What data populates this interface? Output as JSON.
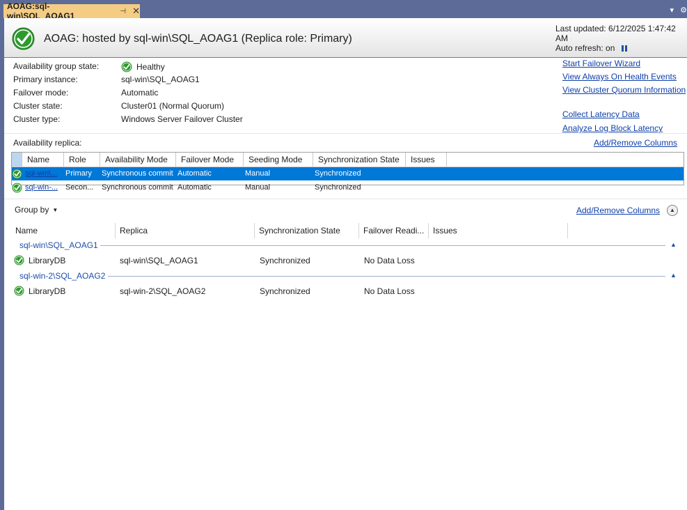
{
  "tab": {
    "title": "AOAG:sql-win\\SQL_AOAG1",
    "pin": "⊣",
    "close": "✕"
  },
  "strip_icons": {
    "dropdown": "▾",
    "settings": "⚙"
  },
  "header": {
    "title": "AOAG: hosted by sql-win\\SQL_AOAG1 (Replica role: Primary)",
    "last_updated": "Last updated: 6/12/2025 1:47:42 AM",
    "auto_refresh": "Auto refresh: on"
  },
  "info": [
    {
      "label": "Availability group state:",
      "value": "Healthy",
      "icon": "check-icon"
    },
    {
      "label": "Primary instance:",
      "value": "sql-win\\SQL_AOAG1"
    },
    {
      "label": "Failover mode:",
      "value": "Automatic"
    },
    {
      "label": "Cluster state:",
      "value": "Cluster01 (Normal Quorum)"
    },
    {
      "label": "Cluster type:",
      "value": "Windows Server Failover Cluster"
    }
  ],
  "links": [
    "Start Failover Wizard",
    "View Always On Health Events",
    "View Cluster Quorum Information",
    "Collect Latency Data",
    "Analyze Log Block Latency"
  ],
  "replica": {
    "label": "Availability replica:",
    "add_remove": "Add/Remove Columns",
    "columns": [
      "Name",
      "Role",
      "Availability Mode",
      "Failover Mode",
      "Seeding Mode",
      "Synchronization State",
      "Issues"
    ],
    "rows": [
      {
        "name": "sql-win\\...",
        "role": "Primary",
        "availability_mode": "Synchronous commit",
        "failover_mode": "Automatic",
        "seeding_mode": "Manual",
        "sync_state": "Synchronized",
        "issues": "",
        "selected": true
      },
      {
        "name": "sql-win-...",
        "role": "Secon...",
        "availability_mode": "Synchronous commit",
        "failover_mode": "Automatic",
        "seeding_mode": "Manual",
        "sync_state": "Synchronized",
        "issues": "",
        "selected": false
      }
    ]
  },
  "databases": {
    "group_by": "Group by",
    "add_remove": "Add/Remove Columns",
    "columns": [
      "Name",
      "Replica",
      "Synchronization State",
      "Failover Readi...",
      "Issues"
    ],
    "groups": [
      {
        "title": "sql-win\\SQL_AOAG1",
        "rows": [
          {
            "name": "LibraryDB",
            "replica": "sql-win\\SQL_AOAG1",
            "sync_state": "Synchronized",
            "failover_readiness": "No Data Loss",
            "issues": ""
          }
        ]
      },
      {
        "title": "sql-win-2\\SQL_AOAG2",
        "rows": [
          {
            "name": "LibraryDB",
            "replica": "sql-win-2\\SQL_AOAG2",
            "sync_state": "Synchronized",
            "failover_readiness": "No Data Loss",
            "issues": ""
          }
        ]
      }
    ]
  },
  "colors": {
    "accent": "#0078d7",
    "healthy": "#2e9a2e",
    "link": "#0e3fa8",
    "tab": "#f5cc84",
    "chrome": "#5d6b99"
  }
}
